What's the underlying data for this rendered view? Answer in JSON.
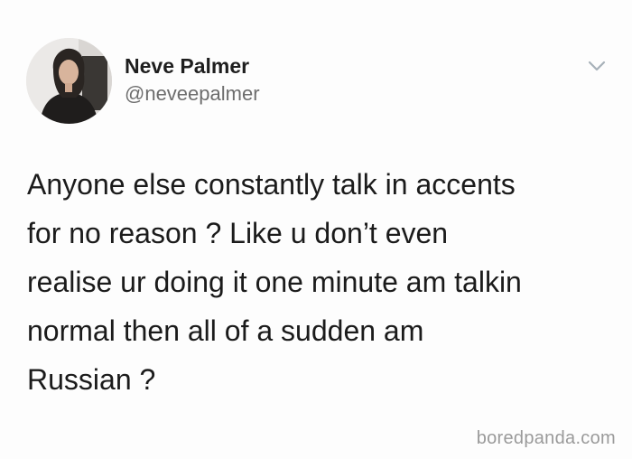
{
  "tweet": {
    "author": {
      "display_name": "Neve Palmer",
      "handle": "@neveepalmer",
      "avatar_icon": "profile-photo"
    },
    "menu_icon": "chevron-down-icon",
    "text": "Anyone else constantly talk in accents\nfor no reason ? Like u don’t even\nrealise ur doing it one minute am talkin\nnormal then all of a sudden am\nRussian ?"
  },
  "watermark": "boredpanda.com",
  "colors": {
    "background": "#fdfdfd",
    "name": "#1e1e1e",
    "handle": "#6d6d6d",
    "chevron": "#a7b1b9",
    "watermark": "#9a9a9a"
  }
}
